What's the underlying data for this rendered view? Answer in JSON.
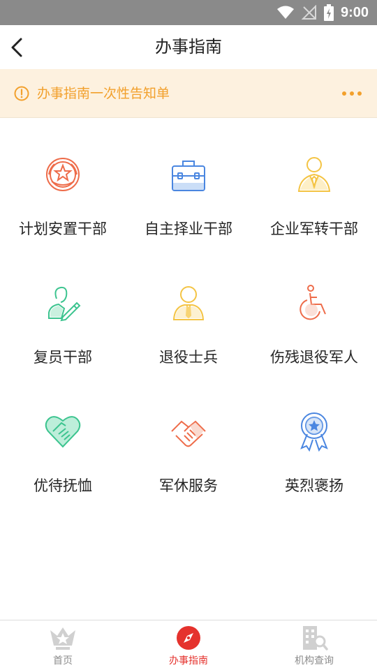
{
  "status_bar": {
    "time": "9:00"
  },
  "header": {
    "title": "办事指南"
  },
  "notice": {
    "text": "办事指南一次性告知单"
  },
  "grid": {
    "items": [
      {
        "label": "计划安置干部",
        "icon": "army-badge-icon",
        "color": "#ee6c4a"
      },
      {
        "label": "自主择业干部",
        "icon": "briefcase-icon",
        "color": "#4a86e0"
      },
      {
        "label": "企业军转干部",
        "icon": "businessman-icon",
        "color": "#f4c444"
      },
      {
        "label": "复员干部",
        "icon": "person-edit-icon",
        "color": "#3cc48f"
      },
      {
        "label": "退役士兵",
        "icon": "person-tie-icon",
        "color": "#f4c444"
      },
      {
        "label": "伤残退役军人",
        "icon": "wheelchair-icon",
        "color": "#ee6c4a"
      },
      {
        "label": "优待抚恤",
        "icon": "heart-handshake-icon",
        "color": "#3cc48f"
      },
      {
        "label": "军休服务",
        "icon": "handshake-icon",
        "color": "#ee6c4a"
      },
      {
        "label": "英烈褒扬",
        "icon": "medal-icon",
        "color": "#4a86e0"
      }
    ]
  },
  "tabbar": {
    "tabs": [
      {
        "label": "首页",
        "icon": "army-star-icon"
      },
      {
        "label": "办事指南",
        "icon": "compass-icon",
        "active": true
      },
      {
        "label": "机构查询",
        "icon": "building-search-icon"
      }
    ]
  },
  "colors": {
    "accent": "#e5322d",
    "notice_bg": "#fdf1df",
    "notice_text": "#f2a02c",
    "status_bar": "#8a8a8a"
  }
}
